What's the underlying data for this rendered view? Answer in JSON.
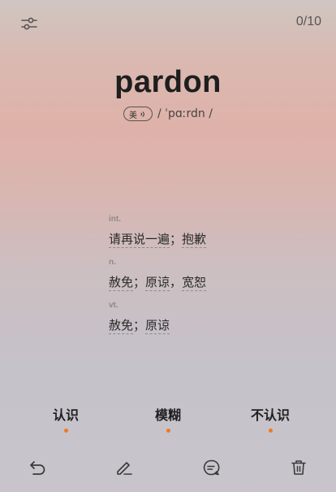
{
  "header": {
    "counter": "0/10"
  },
  "card": {
    "word": "pardon",
    "region": "美",
    "phonetic": "/ ˈpɑːrdn /"
  },
  "definitions": [
    {
      "pos": "int.",
      "meanings": [
        "请再说一遍",
        "抱歉"
      ],
      "separators": [
        "；"
      ]
    },
    {
      "pos": "n.",
      "meanings": [
        "赦免",
        "原谅",
        "宽恕"
      ],
      "separators": [
        "；",
        "，"
      ]
    },
    {
      "pos": "vt.",
      "meanings": [
        "赦免",
        "原谅"
      ],
      "separators": [
        "；"
      ]
    }
  ],
  "answers": {
    "know": "认识",
    "vague": "模糊",
    "unknown": "不认识"
  },
  "colors": {
    "accent": "#f07a1f"
  },
  "icons": {
    "settings": "sliders-icon",
    "undo": "undo-icon",
    "edit": "pencil-icon",
    "comment": "comment-icon",
    "delete": "trash-icon",
    "audio": "speaker-icon"
  }
}
